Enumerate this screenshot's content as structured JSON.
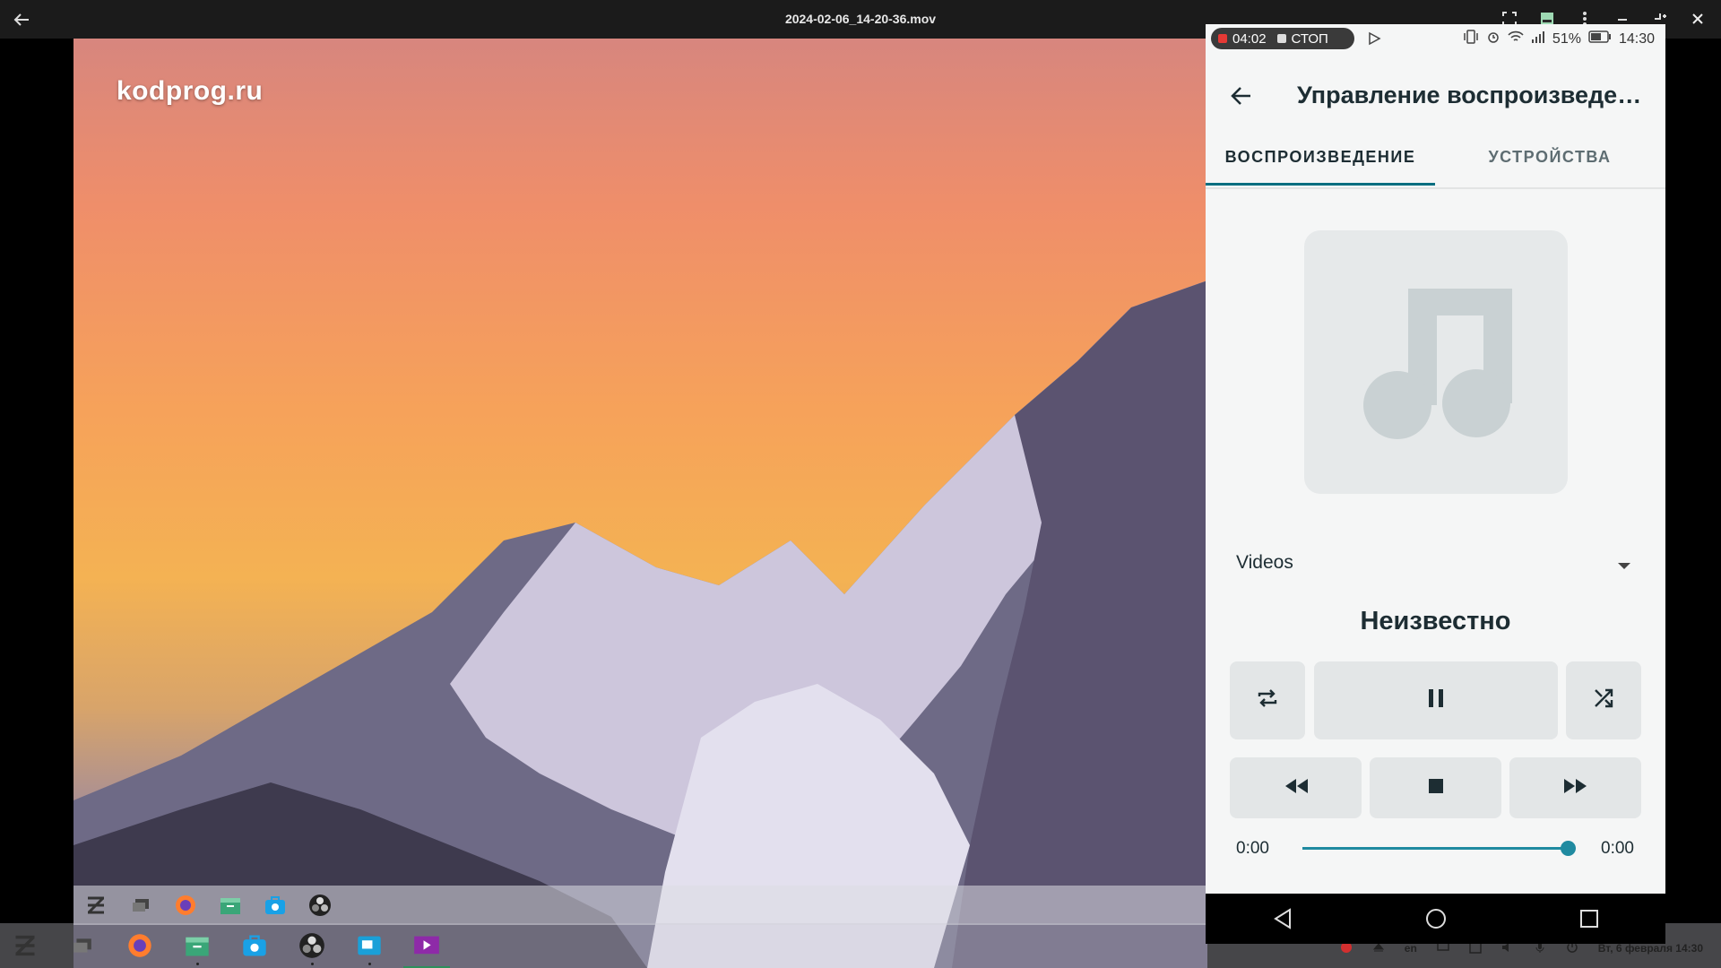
{
  "window": {
    "title": "2024-02-06_14-20-36.mov"
  },
  "watermark": "kodprog.ru",
  "phone": {
    "statusbar": {
      "rec_time": "04:02",
      "stop_label": "СТОП",
      "battery": "51%",
      "clock": "14:30"
    },
    "appbar": {
      "title": "Управление воспроизведен…"
    },
    "tabs": [
      {
        "label": "ВОСПРОИЗВЕДЕНИЕ",
        "active": true
      },
      {
        "label": "УСТРОЙСТВА",
        "active": false
      }
    ],
    "media_source": "Videos",
    "track_title": "Неизвестно",
    "controls": {
      "repeat": "repeat-icon",
      "play_pause": "pause-icon",
      "shuffle": "shuffle-icon",
      "rewind": "rewind-icon",
      "stop": "stop-icon",
      "forward": "fast-forward-icon"
    },
    "progress": {
      "elapsed": "0:00",
      "duration": "0:00",
      "position_fraction": 1.0
    }
  },
  "taskbar": {
    "lang": "en",
    "datetime": "Вт, 6 февраля  14:30"
  },
  "colors": {
    "accent": "#006e80",
    "slider": "#1f8aa0"
  }
}
